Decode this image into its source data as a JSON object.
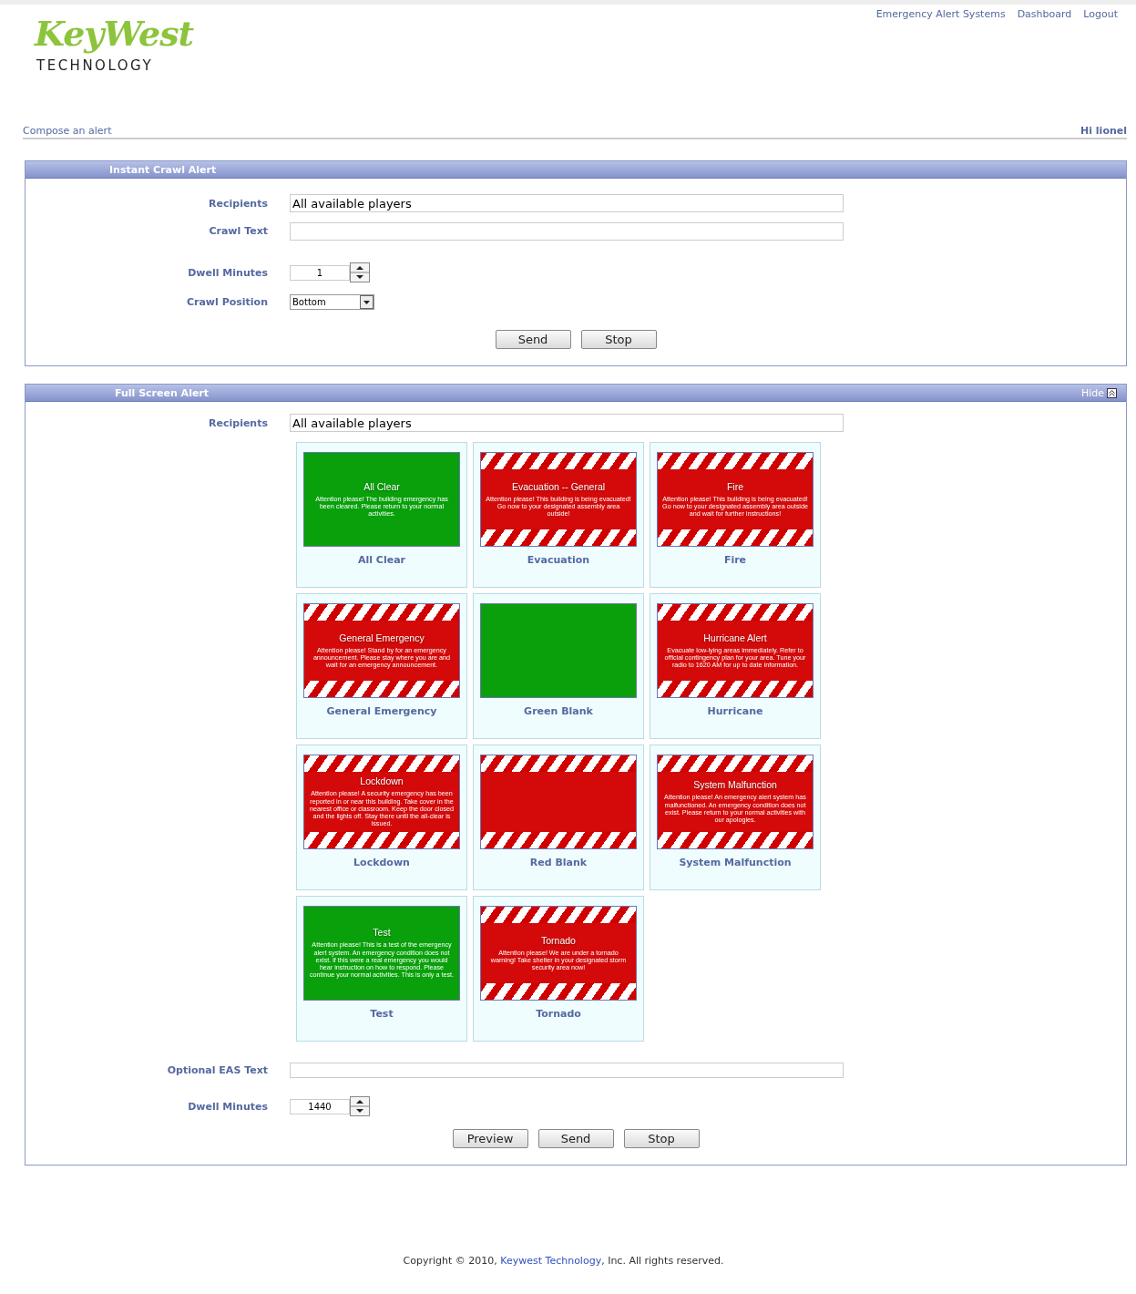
{
  "logo": {
    "script": "KeyWest",
    "wordmark": "TECHNOLOGY"
  },
  "top_nav": [
    "Emergency Alert Systems",
    "Dashboard",
    "Logout"
  ],
  "breadcrumb": "Compose an alert",
  "greeting": "Hi lionel",
  "crawl_panel": {
    "title": "Instant Crawl Alert",
    "recipients": {
      "label": "Recipients",
      "value": "All available players"
    },
    "crawl_text": {
      "label": "Crawl Text"
    },
    "dwell": {
      "label": "Dwell Minutes",
      "value": "1"
    },
    "position": {
      "label": "Crawl Position",
      "value": "Bottom"
    },
    "buttons": [
      "Send",
      "Stop"
    ]
  },
  "full_panel": {
    "title": "Full Screen Alert",
    "hide": "Hide",
    "recipients": {
      "label": "Recipients",
      "value": "All available players"
    },
    "alerts": [
      {
        "name": "All Clear",
        "kind": "green",
        "title": "All Clear",
        "body": "Attention please! The building emergency has been cleared. Please return to your normal activities."
      },
      {
        "name": "Evacuation",
        "kind": "red",
        "title": "Evacuation -- General",
        "body": "Attention please! This building is being evacuated! Go now to your designated assembly area outside!"
      },
      {
        "name": "Fire",
        "kind": "red",
        "title": "Fire",
        "body": "Attention please! This building is being evacuated! Go now to your designated assembly area outside and wait for further instructions!"
      },
      {
        "name": "General Emergency",
        "kind": "red",
        "title": "General Emergency",
        "body": "Attention please! Stand by for an emergency announcement. Please stay where you are and wait for an emergency announcement."
      },
      {
        "name": "Green Blank",
        "kind": "green"
      },
      {
        "name": "Hurricane",
        "kind": "red",
        "title": "Hurricane Alert",
        "body": "Evacuate low-lying areas immediately. Refer to official contingency plan for your area. Tune your radio to 1620 AM for up to date information."
      },
      {
        "name": "Lockdown",
        "kind": "red",
        "title": "Lockdown",
        "body": "Attention please! A security emergency has been reported in or near this building. Take cover in the nearest office or classroom. Keep the door closed and the lights off. Stay there until the all-clear is issued."
      },
      {
        "name": "Red Blank",
        "kind": "red"
      },
      {
        "name": "System Malfunction",
        "kind": "red",
        "title": "System Malfunction",
        "body": "Attention please! An emergency alert system has malfunctioned. An emergency condition does not exist. Please return to your normal activities with our apologies."
      },
      {
        "name": "Test",
        "kind": "green",
        "title": "Test",
        "body": "Attention please! This is a test of the emergency alert system. An emergency condition does not exist. if this were a real emergency you would hear instruction on how to respond. Please continue your normal activities. This is only a test."
      },
      {
        "name": "Tornado",
        "kind": "red",
        "title": "Tornado",
        "body": "Attention please! We are under a tornado warning! Take shelter in your designated storm security area now!"
      }
    ],
    "eas_text": {
      "label": "Optional EAS Text"
    },
    "dwell": {
      "label": "Dwell Minutes",
      "value": "1440"
    },
    "buttons": [
      "Preview",
      "Send",
      "Stop"
    ]
  },
  "footer": {
    "before": "Copyright © 2010, ",
    "link": "Keywest Technology",
    "after": ", Inc. All rights reserved."
  }
}
